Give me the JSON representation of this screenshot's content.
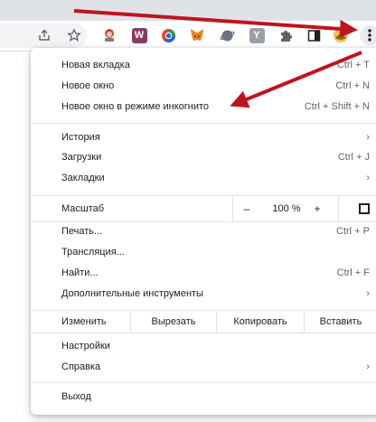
{
  "toolbar": {
    "icons": [
      "share-icon",
      "bookmark-star-icon",
      "extension-1-icon",
      "extension-w-icon",
      "extension-color-icon",
      "metamask-fox-icon",
      "extension-planet-icon",
      "extension-y-icon",
      "extensions-puzzle-icon",
      "side-panel-icon",
      "profile-avatar-icon",
      "menu-dots-icon"
    ],
    "ext_w_letter": "W",
    "ext_y_letter": "Y"
  },
  "menu": {
    "new_tab": {
      "label": "Новая вкладка",
      "shortcut": "Ctrl + T"
    },
    "new_window": {
      "label": "Новое окно",
      "shortcut": "Ctrl + N"
    },
    "incognito": {
      "label": "Новое окно в режиме инкогнито",
      "shortcut": "Ctrl + Shift + N"
    },
    "history": {
      "label": "История"
    },
    "downloads": {
      "label": "Загрузки",
      "shortcut": "Ctrl + J"
    },
    "bookmarks": {
      "label": "Закладки"
    },
    "zoom": {
      "label": "Масштаб",
      "minus": "–",
      "value": "100 %",
      "plus": "+"
    },
    "print": {
      "label": "Печать...",
      "shortcut": "Ctrl + P"
    },
    "cast": {
      "label": "Трансляция..."
    },
    "find": {
      "label": "Найти...",
      "shortcut": "Ctrl + F"
    },
    "more_tools": {
      "label": "Дополнительные инструменты"
    },
    "edit": {
      "label": "Изменить",
      "cut": "Вырезать",
      "copy": "Копировать",
      "paste": "Вставить"
    },
    "settings": {
      "label": "Настройки"
    },
    "help": {
      "label": "Справка"
    },
    "exit": {
      "label": "Выход"
    }
  },
  "annotation_color": "#c0141c"
}
